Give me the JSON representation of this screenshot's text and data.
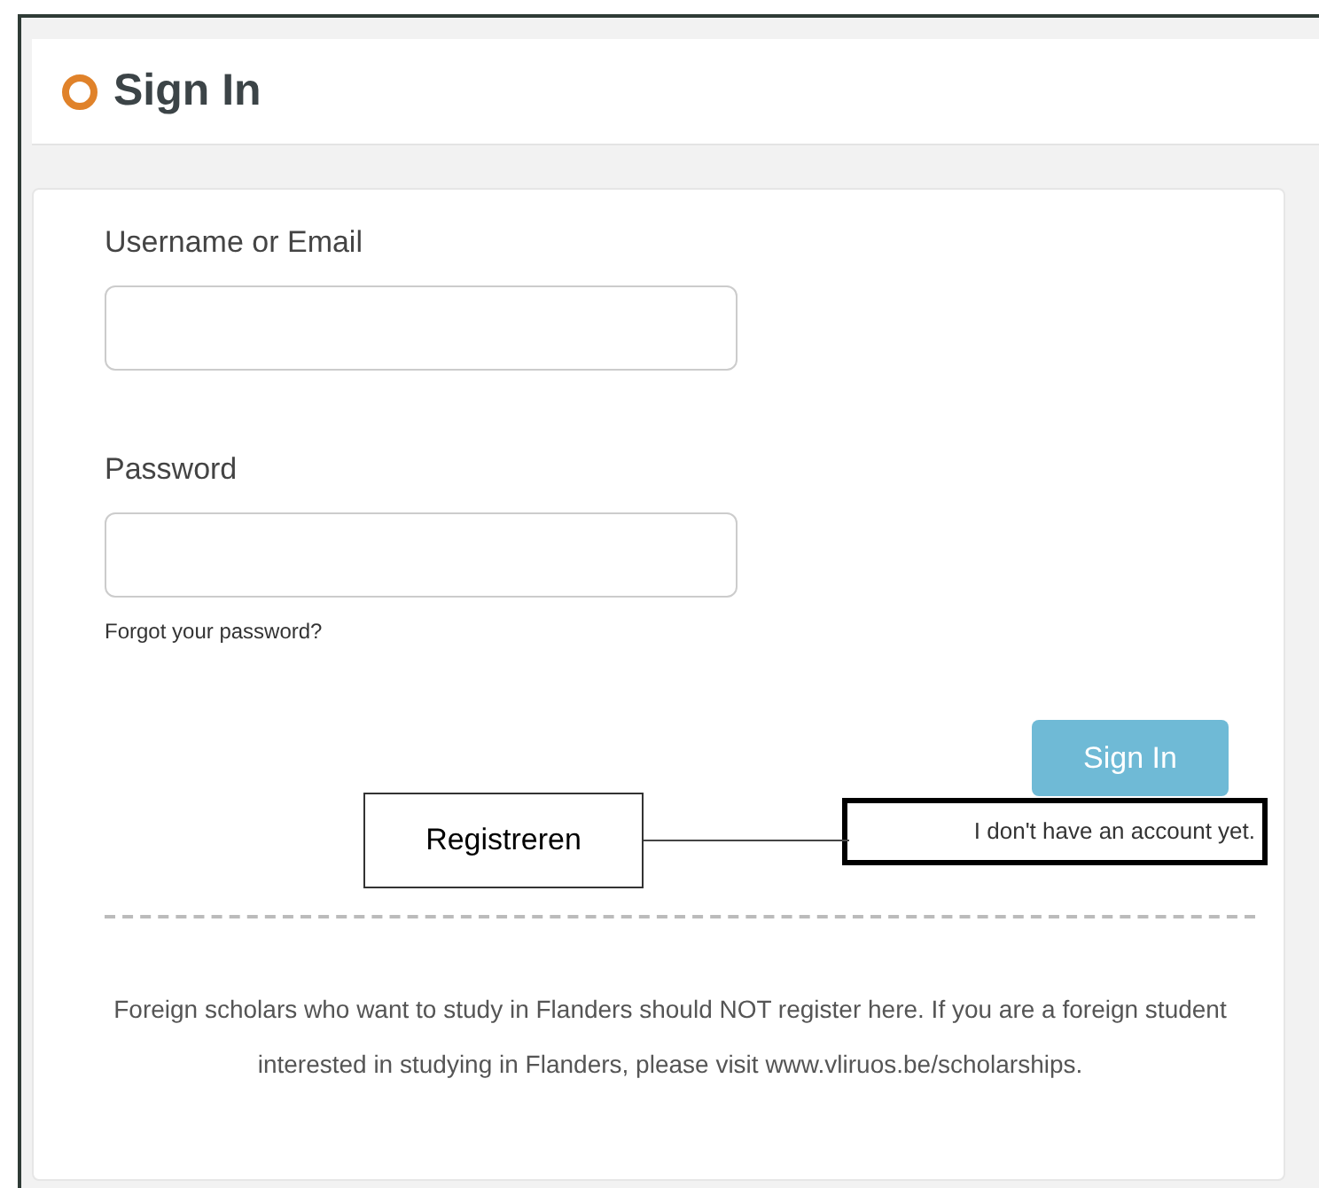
{
  "header": {
    "title": "Sign In"
  },
  "form": {
    "fields": [
      {
        "label": "Username or Email"
      },
      {
        "label": "Password"
      }
    ],
    "forgot_link": "Forgot your password?",
    "submit_button": "Sign In",
    "account_link": {
      "text": "I don't have an account yet.",
      "highlighted": true
    }
  },
  "annotation": {
    "label": "Registreren"
  },
  "notice": "Foreign scholars who want to study in Flanders should NOT register here. If you are a foreign student interested in studying in Flanders, please visit www.vliruos.be/scholarships."
}
